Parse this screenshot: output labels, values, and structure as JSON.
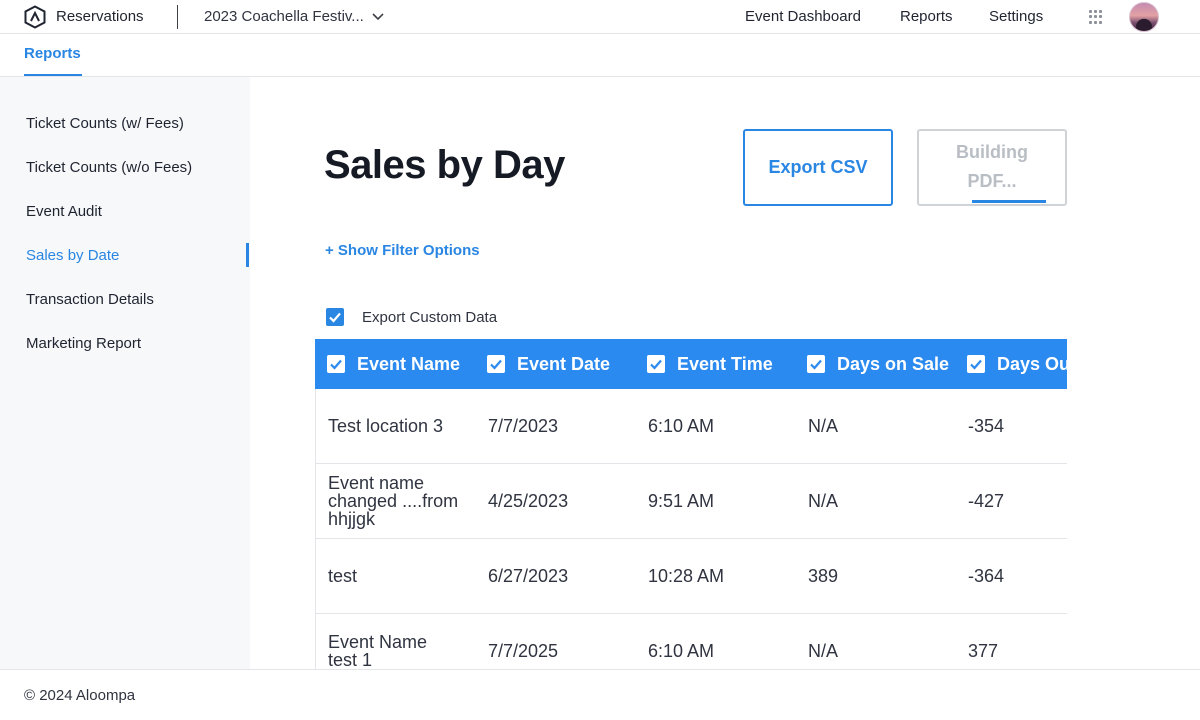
{
  "header": {
    "app_name": "Reservations",
    "event_selector": "2023 Coachella Festiv...",
    "nav": [
      "Event Dashboard",
      "Reports",
      "Settings"
    ],
    "apps_icon": "grid-icon",
    "avatar_icon": "user-avatar"
  },
  "subnav": {
    "active_tab": "Reports"
  },
  "sidebar": {
    "items": [
      {
        "label": "Ticket Counts (w/ Fees)",
        "active": false
      },
      {
        "label": "Ticket Counts (w/o Fees)",
        "active": false
      },
      {
        "label": "Event Audit",
        "active": false
      },
      {
        "label": "Sales by Date",
        "active": true
      },
      {
        "label": "Transaction Details",
        "active": false
      },
      {
        "label": "Marketing Report",
        "active": false
      }
    ]
  },
  "main": {
    "title": "Sales by Day",
    "export_csv": "Export CSV",
    "pdf_button": {
      "line1": "Building",
      "line2": "PDF..."
    },
    "filter_link": "+ Show Filter Options",
    "custom_data_label": "Export Custom Data",
    "custom_data_checked": true
  },
  "table": {
    "columns": [
      "Event Name",
      "Event Date",
      "Event Time",
      "Days on Sale",
      "Days Ou"
    ],
    "rows": [
      [
        "Test location 3",
        "7/7/2023",
        "6:10 AM",
        "N/A",
        "-354"
      ],
      [
        "Event name changed ....from hhjjgk",
        "4/25/2023",
        "9:51 AM",
        "N/A",
        "-427"
      ],
      [
        "test",
        "6/27/2023",
        "10:28 AM",
        "389",
        "-364"
      ],
      [
        "Event Name test 1",
        "7/7/2025",
        "6:10 AM",
        "N/A",
        "377"
      ]
    ]
  },
  "footer": {
    "copyright": "© 2024 Aloompa"
  },
  "colors": {
    "accent": "#2a86e3",
    "table_header": "#2a8af0",
    "sidebar_bg": "#f7f8fa"
  }
}
